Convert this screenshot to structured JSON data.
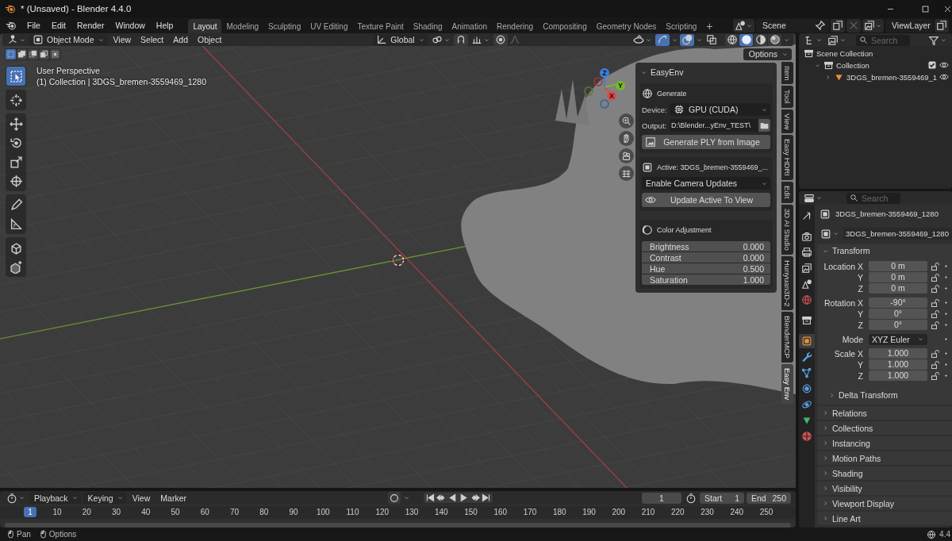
{
  "window": {
    "title": "* (Unsaved) - Blender 4.4.0"
  },
  "menus": [
    "File",
    "Edit",
    "Render",
    "Window",
    "Help"
  ],
  "workspaces": [
    {
      "label": "Layout",
      "selected": true
    },
    {
      "label": "Modeling",
      "selected": false
    },
    {
      "label": "Sculpting",
      "selected": false
    },
    {
      "label": "UV Editing",
      "selected": false
    },
    {
      "label": "Texture Paint",
      "selected": false
    },
    {
      "label": "Shading",
      "selected": false
    },
    {
      "label": "Animation",
      "selected": false
    },
    {
      "label": "Rendering",
      "selected": false
    },
    {
      "label": "Compositing",
      "selected": false
    },
    {
      "label": "Geometry Nodes",
      "selected": false
    },
    {
      "label": "Scripting",
      "selected": false
    }
  ],
  "add_workspace": "+",
  "scene": "Scene",
  "view_layer": "ViewLayer",
  "viewport": {
    "mode": "Object Mode",
    "menus": [
      "View",
      "Select",
      "Add",
      "Object"
    ],
    "orientation": "Global",
    "toggles": [
      {
        "kind": "gizmo",
        "on": true
      },
      {
        "kind": "overlay",
        "on": true
      },
      {
        "kind": "xray",
        "on": false
      }
    ],
    "shading_modes": [
      {
        "kind": "wireframe",
        "selected": false
      },
      {
        "kind": "solid",
        "selected": true
      },
      {
        "kind": "material",
        "selected": false
      },
      {
        "kind": "rendered",
        "selected": false
      }
    ],
    "select_modes": [
      {
        "selected": true
      },
      {
        "selected": false
      },
      {
        "selected": false
      },
      {
        "selected": false
      },
      {
        "selected": false
      }
    ],
    "options": "Options",
    "tool_groups": [
      [
        {
          "kind": "select",
          "selected": true
        }
      ],
      [
        {
          "kind": "cursor",
          "selected": false
        }
      ],
      [
        {
          "kind": "move",
          "selected": false
        },
        {
          "kind": "rotate",
          "selected": false
        },
        {
          "kind": "scale",
          "selected": false
        },
        {
          "kind": "transform",
          "selected": false
        }
      ],
      [
        {
          "kind": "annotate",
          "selected": false
        },
        {
          "kind": "measure",
          "selected": false
        }
      ],
      [
        {
          "kind": "add_cube",
          "selected": false
        },
        {
          "kind": "add_cube_alt",
          "selected": false
        }
      ]
    ],
    "info": [
      "User Perspective",
      "(1) Collection | 3DGS_bremen-3559469_1280"
    ],
    "gizmo_axes": [
      "Z",
      "Y",
      "X"
    ],
    "nav": [
      {
        "kind": "zoom"
      },
      {
        "kind": "pan"
      },
      {
        "kind": "camera"
      },
      {
        "kind": "grid"
      }
    ]
  },
  "sidebar": {
    "title": "EasyEnv",
    "generate": {
      "title": "Generate",
      "device_label": "Device:",
      "device": "GPU (CUDA)",
      "output_label": "Output:",
      "output": "D:\\Blender...yEnv_TEST\\",
      "button": "Generate PLY from Image"
    },
    "active": {
      "title": "Active: 3DGS_bremen-3559469_...",
      "dropdown": "Enable Camera Updates",
      "button": "Update Active To View"
    },
    "color_adjustment": {
      "title": "Color Adjustment",
      "fields": [
        {
          "label": "Brightness",
          "value": "0.000"
        },
        {
          "label": "Contrast",
          "value": "0.000"
        },
        {
          "label": "Hue",
          "value": "0.500"
        },
        {
          "label": "Saturation",
          "value": "1.000"
        }
      ]
    },
    "tabs": [
      {
        "label": "Item",
        "selected": false
      },
      {
        "label": "Tool",
        "selected": false
      },
      {
        "label": "View",
        "selected": false
      },
      {
        "label": "Easy HDRI",
        "selected": false
      },
      {
        "label": "Edit",
        "selected": false
      },
      {
        "label": "3D AI Studio",
        "selected": false
      },
      {
        "label": "Hunyuan3D-2",
        "selected": false
      },
      {
        "label": "BlenderMCP",
        "selected": false
      },
      {
        "label": "Easy Env",
        "selected": true
      }
    ]
  },
  "outliner": {
    "search_placeholder": "Search",
    "items": [
      {
        "label": "Scene Collection",
        "kind": "scene",
        "children": [
          {
            "label": "Collection",
            "kind": "collection",
            "expanded": true,
            "checked": true,
            "children": [
              {
                "label": "3DGS_bremen-3559469_1",
                "kind": "mesh",
                "expanded": false
              }
            ]
          }
        ]
      }
    ]
  },
  "properties": {
    "search_placeholder": "Search",
    "tab_groups": [
      [
        {
          "kind": "tool",
          "selected": false
        }
      ],
      [
        {
          "kind": "render",
          "selected": false
        },
        {
          "kind": "output",
          "selected": false
        },
        {
          "kind": "view_layer",
          "selected": false
        },
        {
          "kind": "scene",
          "selected": false
        },
        {
          "kind": "world",
          "selected": false
        }
      ],
      [
        {
          "kind": "collection",
          "selected": false
        }
      ],
      [
        {
          "kind": "object",
          "selected": true
        },
        {
          "kind": "modifiers",
          "selected": false
        },
        {
          "kind": "particles",
          "selected": false
        },
        {
          "kind": "physics",
          "selected": false
        },
        {
          "kind": "constraints",
          "selected": false
        },
        {
          "kind": "data",
          "selected": false
        },
        {
          "kind": "material",
          "selected": false
        }
      ]
    ],
    "object_name": "3DGS_bremen-3559469_1280",
    "datablock": "3DGS_bremen-3559469_1280",
    "transform": {
      "title": "Transform",
      "expanded": true,
      "groups": [
        [
          {
            "label": "Location X",
            "value": "0 m",
            "kind": "number"
          },
          {
            "label": "Y",
            "value": "0 m",
            "kind": "number"
          },
          {
            "label": "Z",
            "value": "0 m",
            "kind": "number"
          }
        ],
        [
          {
            "label": "Rotation X",
            "value": "-90°",
            "kind": "number"
          },
          {
            "label": "Y",
            "value": "0°",
            "kind": "number"
          },
          {
            "label": "Z",
            "value": "0°",
            "kind": "number"
          }
        ],
        [
          {
            "label": "Mode",
            "value": "XYZ Euler",
            "kind": "dropdown"
          }
        ],
        [
          {
            "label": "Scale X",
            "value": "1.000",
            "kind": "number"
          },
          {
            "label": "Y",
            "value": "1.000",
            "kind": "number"
          },
          {
            "label": "Z",
            "value": "1.000",
            "kind": "number"
          }
        ]
      ],
      "subpanel": "Delta Transform"
    },
    "panels": [
      "Relations",
      "Collections",
      "Instancing",
      "Motion Paths",
      "Shading",
      "Visibility",
      "Viewport Display",
      "Line Art"
    ]
  },
  "timeline": {
    "menus": [
      {
        "label": "Playback",
        "kind": "dropdown"
      },
      {
        "label": "Keying",
        "kind": "dropdown"
      },
      {
        "label": "View",
        "kind": "menu"
      },
      {
        "label": "Marker",
        "kind": "menu"
      }
    ],
    "current_frame": "1",
    "start_label": "Start",
    "start": "1",
    "end_label": "End",
    "end": "250",
    "ruler_current": "1",
    "ruler": [
      "10",
      "20",
      "30",
      "40",
      "50",
      "60",
      "70",
      "80",
      "90",
      "100",
      "110",
      "120",
      "130",
      "140",
      "150",
      "160",
      "170",
      "180",
      "190",
      "200",
      "210",
      "220",
      "230",
      "240",
      "250"
    ]
  },
  "status_bar": {
    "hints": [
      "Pan",
      "Options"
    ],
    "version": "4.4"
  }
}
